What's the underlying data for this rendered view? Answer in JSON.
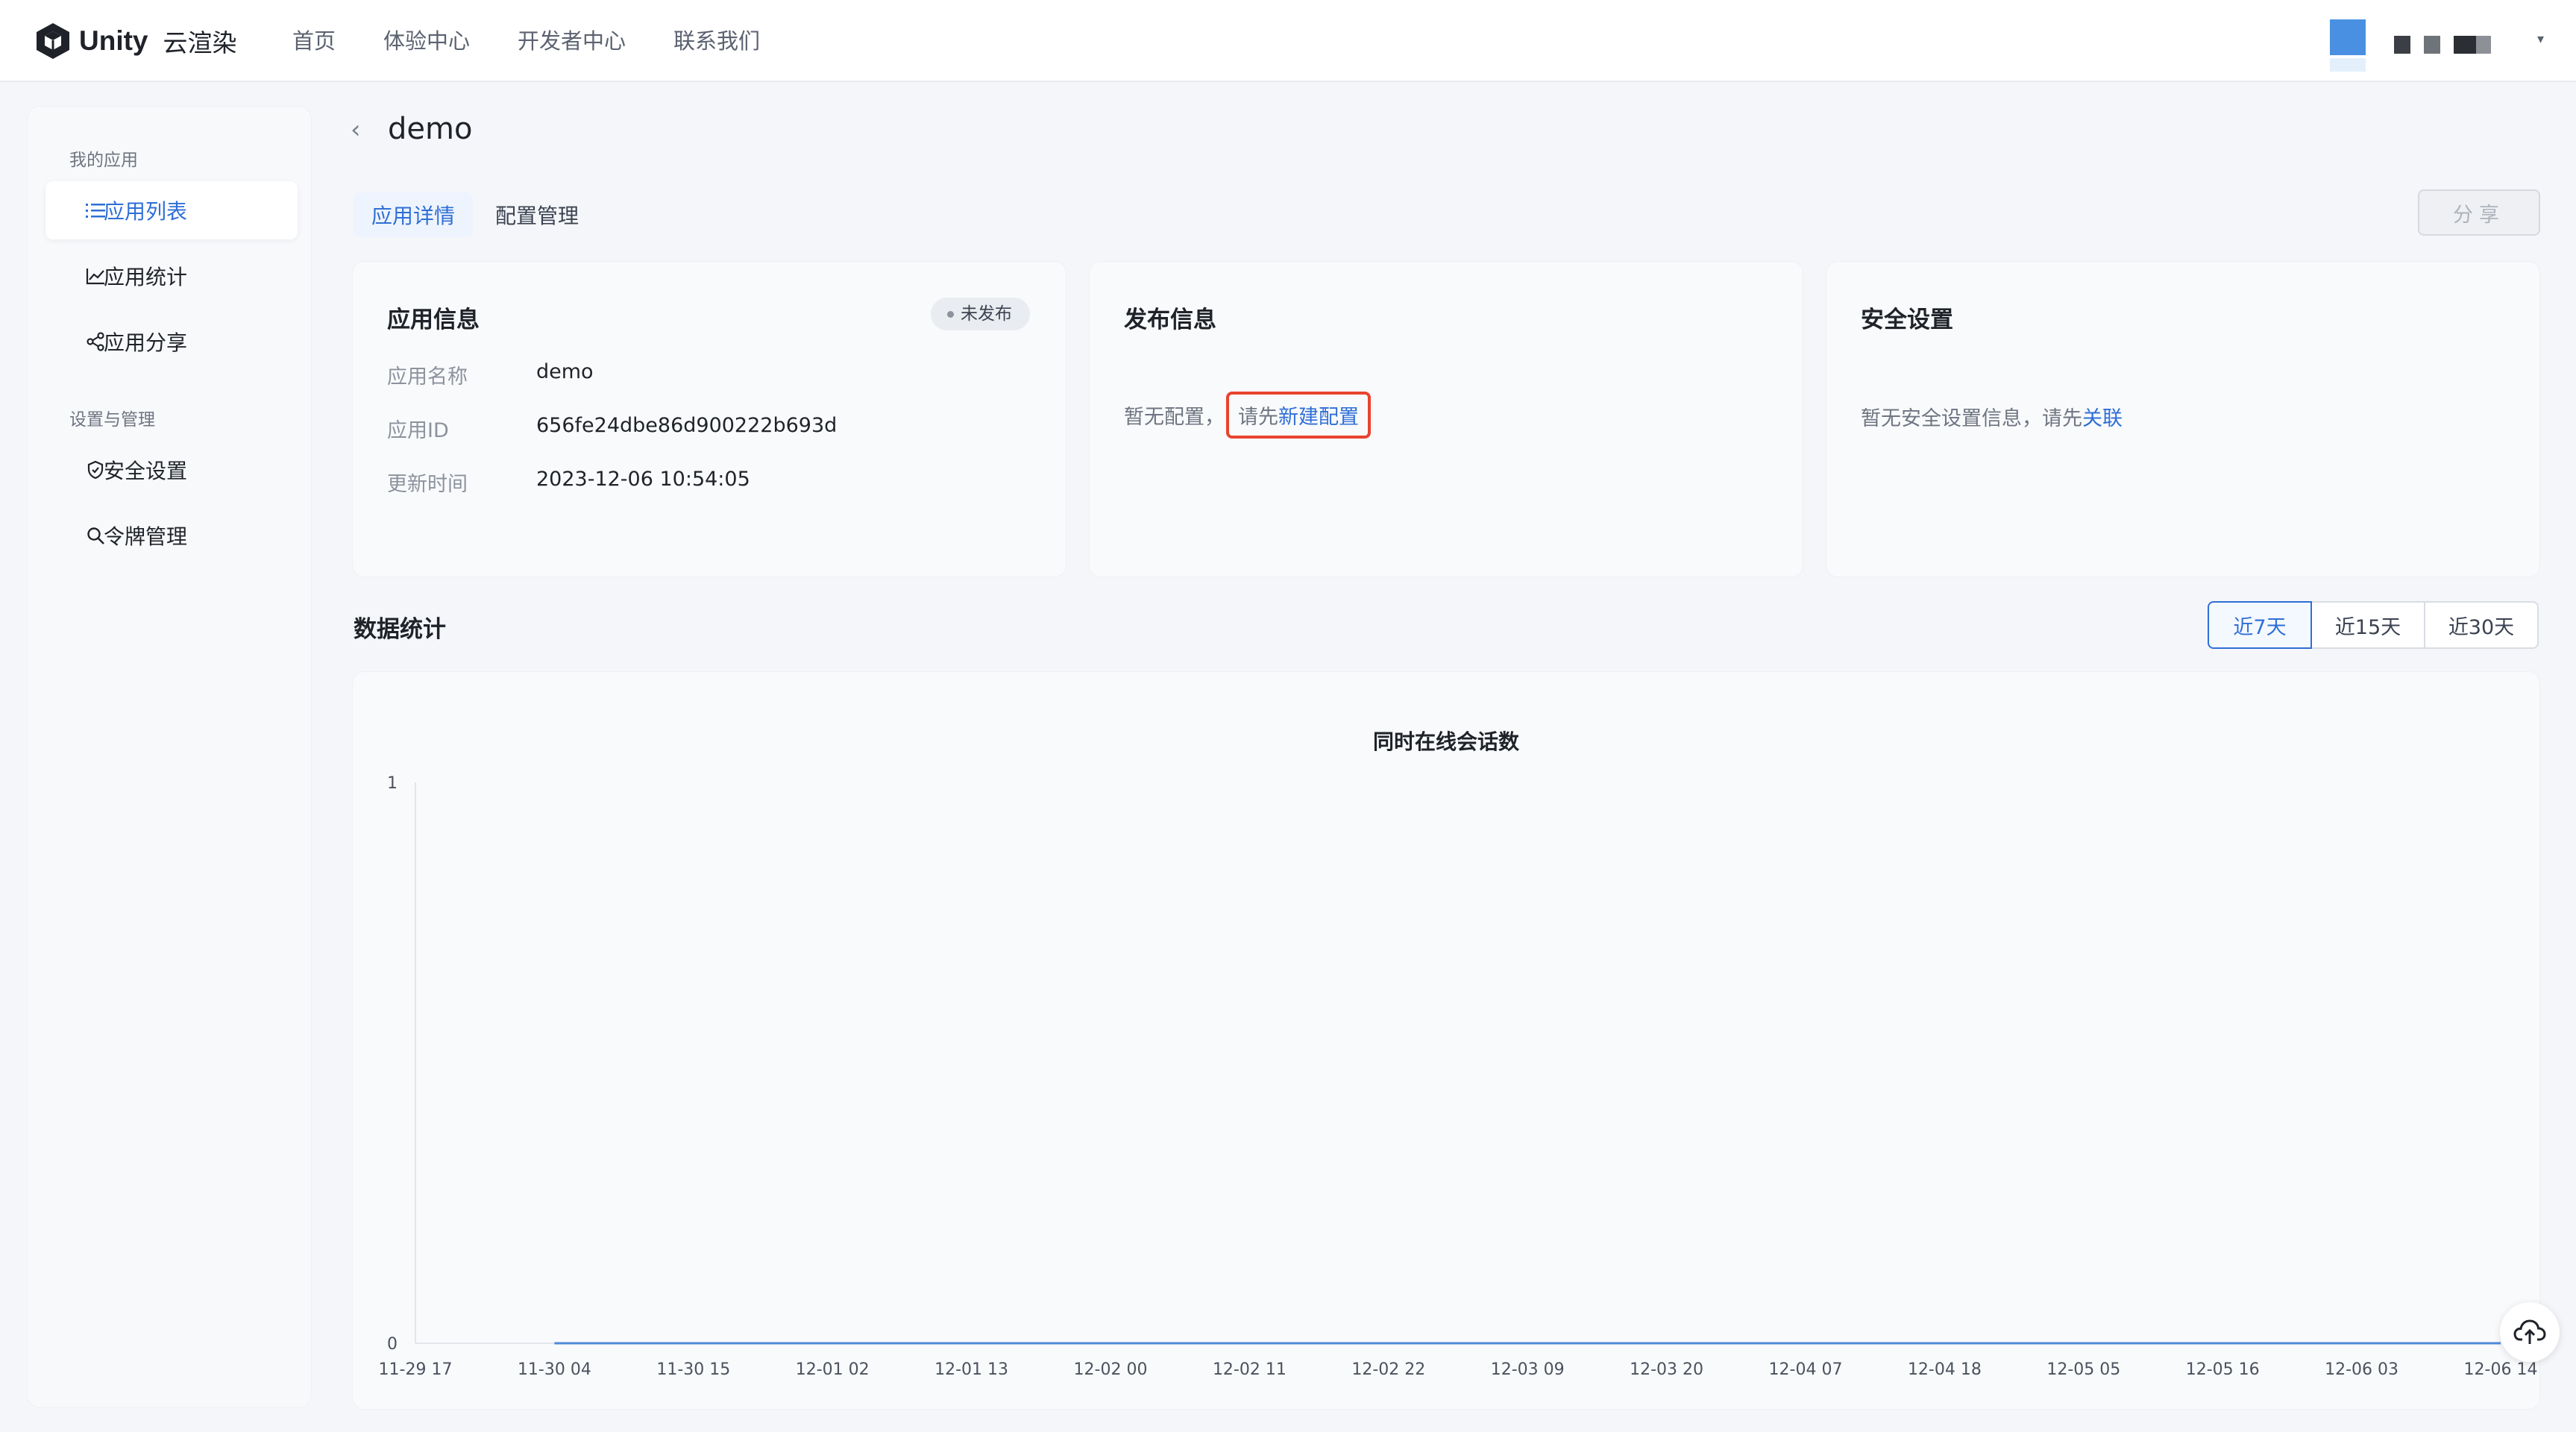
{
  "app": {
    "brand": "Unity",
    "brand_cn": "云渲染"
  },
  "nav": {
    "items": [
      "首页",
      "体验中心",
      "开发者中心",
      "联系我们"
    ]
  },
  "sidebar": {
    "group1": "我的应用",
    "group2": "设置与管理",
    "items": [
      {
        "label": "应用列表",
        "icon": "list-icon"
      },
      {
        "label": "应用统计",
        "icon": "line-chart-icon"
      },
      {
        "label": "应用分享",
        "icon": "share-icon"
      },
      {
        "label": "安全设置",
        "icon": "shield-icon"
      },
      {
        "label": "令牌管理",
        "icon": "search-icon"
      }
    ]
  },
  "page": {
    "title": "demo",
    "tabs": [
      "应用详情",
      "配置管理"
    ],
    "share_label": "分享"
  },
  "app_info": {
    "title": "应用信息",
    "status": "未发布",
    "rows": [
      {
        "label": "应用名称",
        "value": "demo"
      },
      {
        "label": "应用ID",
        "value": "656fe24dbe86d900222b693d"
      },
      {
        "label": "更新时间",
        "value": "2023-12-06 10:54:05"
      }
    ]
  },
  "publish_info": {
    "title": "发布信息",
    "note_prefix": "暂无配置，",
    "note_mid": "请先",
    "link": "新建配置"
  },
  "security": {
    "title": "安全设置",
    "note": "暂无安全设置信息，请先",
    "link": "关联"
  },
  "stats": {
    "title": "数据统计",
    "ranges": [
      "近7天",
      "近15天",
      "近30天"
    ],
    "active_range": "近7天"
  },
  "colors": {
    "accent": "#2f6fd6",
    "highlight": "#e8442e",
    "series": "#4f8ad9"
  },
  "chart_data": {
    "type": "line",
    "title": "同时在线会话数",
    "x": [
      "11-29 17",
      "11-30 04",
      "11-30 15",
      "12-01 02",
      "12-01 13",
      "12-02 00",
      "12-02 11",
      "12-02 22",
      "12-03 09",
      "12-03 20",
      "12-04 07",
      "12-04 18",
      "12-05 05",
      "12-05 16",
      "12-06 03",
      "12-06 14"
    ],
    "series": [
      {
        "values": [
          null,
          0,
          0,
          0,
          0,
          0,
          0,
          0,
          0,
          0,
          0,
          0,
          0,
          0,
          0,
          0
        ]
      }
    ],
    "ylim": [
      0,
      1
    ],
    "yticks": [
      "0",
      "1"
    ],
    "grid": false
  }
}
